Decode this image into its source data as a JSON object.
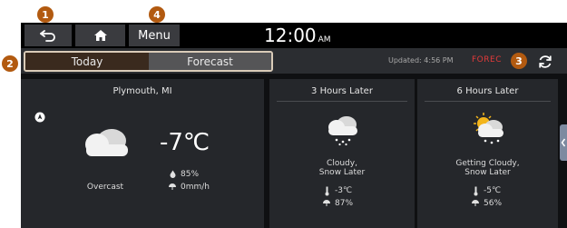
{
  "callouts": {
    "back": "1",
    "tabs": "2",
    "refresh": "3",
    "menu": "4"
  },
  "topbar": {
    "menu_label": "Menu",
    "time": "12:00",
    "ampm": "AM"
  },
  "tabs": {
    "today": "Today",
    "forecast": "Forecast"
  },
  "status": {
    "updated": "Updated: 4:56 PM",
    "source": "FOREC"
  },
  "current": {
    "location": "Plymouth, MI",
    "temperature": "-7℃",
    "condition": "Overcast",
    "humidity": "85%",
    "precipitation": "0mm/h"
  },
  "forecast": [
    {
      "title": "3 Hours Later",
      "condition_line1": "Cloudy,",
      "condition_line2": "Snow Later",
      "temperature": "-3℃",
      "chance": "87%"
    },
    {
      "title": "6 Hours Later",
      "condition_line1": "Getting Cloudy,",
      "condition_line2": "Snow Later",
      "temperature": "-5℃",
      "chance": "56%"
    }
  ],
  "icons": {
    "back": "back-arrow-icon",
    "home": "home-icon",
    "refresh": "refresh-icon",
    "compass": "location-compass-icon",
    "cloud": "cloud-icon",
    "snow_cloud": "snow-cloud-icon",
    "sun_snow_cloud": "sun-snow-cloud-icon",
    "humidity": "humidity-icon",
    "precip": "precipitation-icon",
    "thermometer": "thermometer-icon",
    "chance": "chance-icon"
  },
  "colors": {
    "callout": "#b25a10",
    "tab_border": "#d9cbb8",
    "today_tab": "#3a2a1e",
    "forecast_tab": "#555557",
    "source_red": "#e23a3a"
  }
}
